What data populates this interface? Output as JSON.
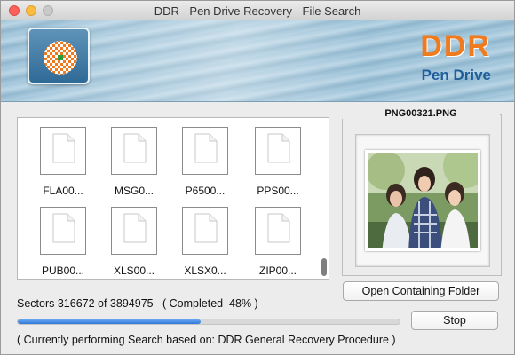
{
  "window": {
    "title": "DDR - Pen Drive Recovery - File Search"
  },
  "banner": {
    "brand_title": "DDR",
    "brand_subtitle": "Pen Drive",
    "brand_title_color": "#f07a1e",
    "brand_subtitle_color": "#1f5d99"
  },
  "files": [
    {
      "label": "FLA00...",
      "icon": "blank-document-icon"
    },
    {
      "label": "MSG0...",
      "icon": "blank-document-icon"
    },
    {
      "label": "P6500...",
      "icon": "blank-document-icon"
    },
    {
      "label": "PPS00...",
      "icon": "blank-document-icon"
    },
    {
      "label": "PUB00...",
      "icon": "blank-document-icon"
    },
    {
      "label": "XLS00...",
      "icon": "blank-document-icon"
    },
    {
      "label": "XLSX0...",
      "icon": "blank-document-icon"
    },
    {
      "label": "ZIP00...",
      "icon": "blank-document-icon"
    }
  ],
  "preview": {
    "filename": "PNG00321.PNG"
  },
  "buttons": {
    "open_folder": "Open Containing Folder",
    "stop": "Stop"
  },
  "progress": {
    "text": "Sectors 316672 of 3894975   ( Completed  48% )",
    "completed_fraction": 0.48,
    "fill_color": "#2f78db"
  },
  "status": {
    "text": "( Currently performing Search based on: DDR General Recovery Procedure )"
  }
}
